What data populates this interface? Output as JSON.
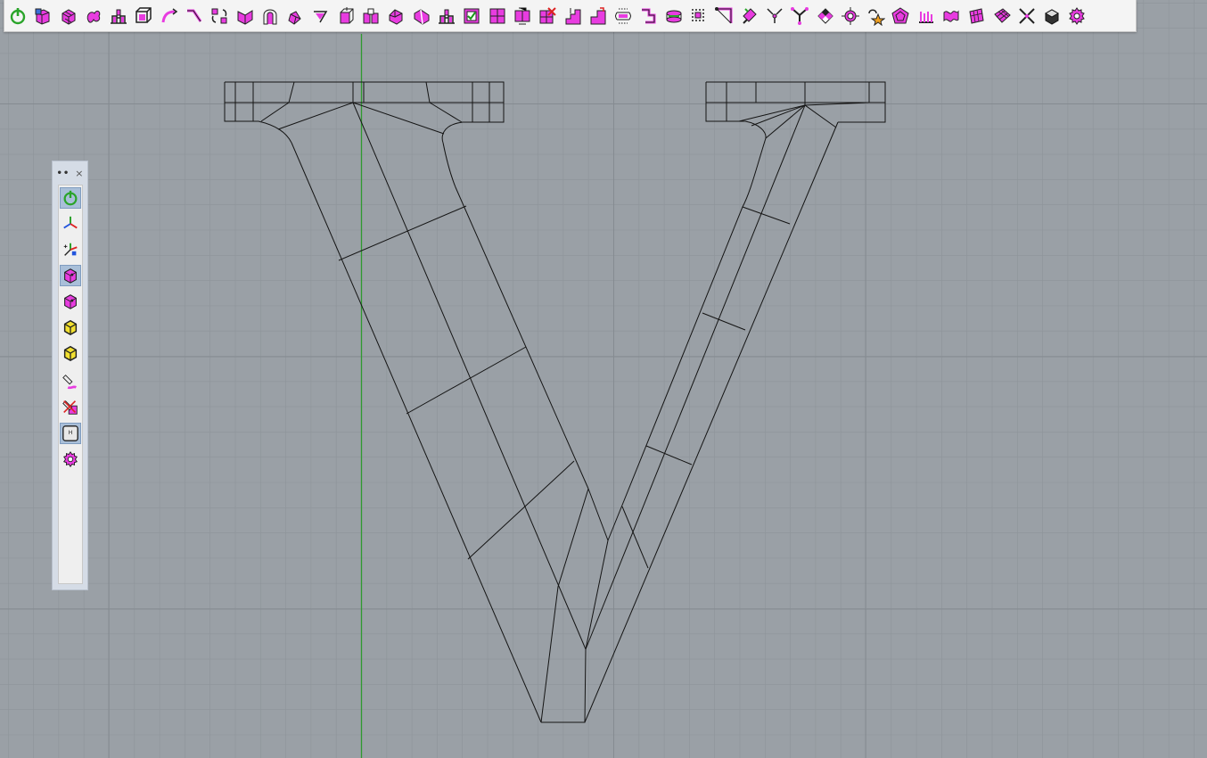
{
  "app": {
    "viewport_background": "#9aa0a6",
    "grid_color": "#8e949a",
    "axis_color": "#2f9a2f",
    "curve_color": "#141414",
    "accent_magenta": "#e83ce0"
  },
  "top_toolbar": {
    "buttons": [
      {
        "name": "power-button",
        "icon": "power-icon"
      },
      {
        "name": "box-button",
        "icon": "box-icon"
      },
      {
        "name": "solid-cage-button",
        "icon": "cage-icon"
      },
      {
        "name": "blob-button",
        "icon": "blob-icon"
      },
      {
        "name": "bridge-button",
        "icon": "bridge-icon"
      },
      {
        "name": "cube-frame-button",
        "icon": "cube-frame-icon"
      },
      {
        "name": "curve-button",
        "icon": "curve-icon"
      },
      {
        "name": "bend-button",
        "icon": "bend-icon"
      },
      {
        "name": "rotate-button",
        "icon": "rotate-icon"
      },
      {
        "name": "fold-button",
        "icon": "fold-icon"
      },
      {
        "name": "arch-button",
        "icon": "arch-icon"
      },
      {
        "name": "twist-button",
        "icon": "twist-icon"
      },
      {
        "name": "crease-button",
        "icon": "crease-icon"
      },
      {
        "name": "extrude-button",
        "icon": "extrude-icon"
      },
      {
        "name": "insert-button",
        "icon": "insert-icon"
      },
      {
        "name": "bevel-button",
        "icon": "bevel-icon"
      },
      {
        "name": "slide-button",
        "icon": "slide-icon"
      },
      {
        "name": "bridge-faces-button",
        "icon": "bridge-icon"
      },
      {
        "name": "check-button",
        "icon": "check-icon"
      },
      {
        "name": "subdivide-button",
        "icon": "grid-icon"
      },
      {
        "name": "merge-button",
        "icon": "merge-icon"
      },
      {
        "name": "delete-button",
        "icon": "delete-icon"
      },
      {
        "name": "stairs-button",
        "icon": "stairs-icon"
      },
      {
        "name": "step-button",
        "icon": "step-icon"
      },
      {
        "name": "loop-button",
        "icon": "loop-icon"
      },
      {
        "name": "flip-button",
        "icon": "flip-icon"
      },
      {
        "name": "ring-button",
        "icon": "ring-icon"
      },
      {
        "name": "points-button",
        "icon": "points-icon"
      },
      {
        "name": "corner-button",
        "icon": "corner-icon"
      },
      {
        "name": "brush-button",
        "icon": "brush-icon"
      },
      {
        "name": "split-button",
        "icon": "split-icon"
      },
      {
        "name": "y-split-button",
        "icon": "y-split-icon"
      },
      {
        "name": "checker-button",
        "icon": "checker-icon"
      },
      {
        "name": "target-button",
        "icon": "target-icon"
      },
      {
        "name": "star-button",
        "icon": "star-icon"
      },
      {
        "name": "polygon-button",
        "icon": "polygon-icon"
      },
      {
        "name": "comb-button",
        "icon": "comb-icon"
      },
      {
        "name": "wave-button",
        "icon": "wave-icon"
      },
      {
        "name": "surface-button",
        "icon": "surface-icon"
      },
      {
        "name": "surface-grid-button",
        "icon": "surface-grid-icon"
      },
      {
        "name": "cross-button",
        "icon": "cross-icon"
      },
      {
        "name": "dark-cube-button",
        "icon": "dark-cube-icon"
      },
      {
        "name": "settings-gear-button",
        "icon": "gear-icon"
      }
    ]
  },
  "side_panel": {
    "grip": "••",
    "close": "×",
    "buttons": [
      {
        "name": "power-button",
        "icon": "power-icon",
        "active": true
      },
      {
        "name": "axes-button",
        "icon": "axes-icon",
        "active": false
      },
      {
        "name": "axes-pick-button",
        "icon": "axes-pick-icon",
        "active": false
      },
      {
        "name": "cube-edit-button",
        "icon": "cube-icon",
        "active": true
      },
      {
        "name": "cube-magenta-button",
        "icon": "cube-icon",
        "active": false
      },
      {
        "name": "cube-yellow-button",
        "icon": "cube-yellow-icon",
        "active": false
      },
      {
        "name": "cube-yellow-alt-button",
        "icon": "cube-yellow-icon",
        "active": false
      },
      {
        "name": "pen-button",
        "icon": "pen-icon",
        "active": false
      },
      {
        "name": "pen-cancel-button",
        "icon": "pen-cancel-icon",
        "active": false
      },
      {
        "name": "h-key-button",
        "icon": "h-key-icon",
        "active": true
      },
      {
        "name": "gear-button",
        "icon": "gear-icon",
        "active": false
      }
    ]
  }
}
